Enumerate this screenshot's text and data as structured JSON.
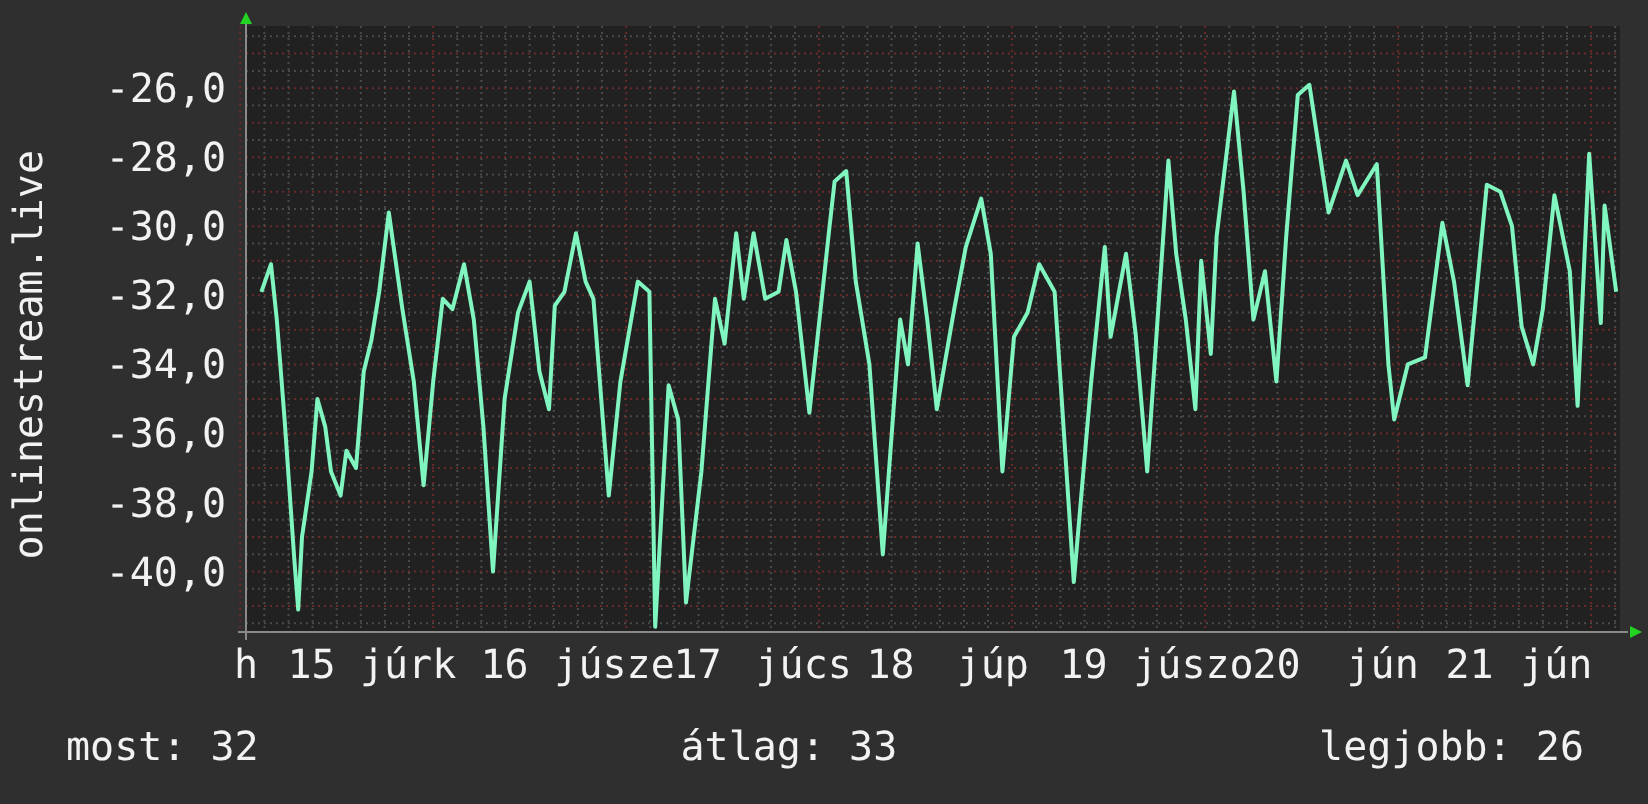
{
  "graph": {
    "chart_data": {
      "type": "line",
      "ylabel": "onlinestream.live",
      "grid": true,
      "xlim": [
        14.66,
        21.78
      ],
      "ylim": [
        -41.75,
        -24.2
      ],
      "yticks": [
        {
          "value": -26,
          "label": "-26,0"
        },
        {
          "value": -28,
          "label": "-28,0"
        },
        {
          "value": -30,
          "label": "-30,0"
        },
        {
          "value": -32,
          "label": "-32,0"
        },
        {
          "value": -34,
          "label": "-34,0"
        },
        {
          "value": -36,
          "label": "-36,0"
        },
        {
          "value": -38,
          "label": "-38,0"
        },
        {
          "value": -40,
          "label": "-40,0"
        }
      ],
      "xticks": [
        {
          "value": 14.66,
          "label": "h"
        },
        {
          "value": 15.0,
          "label": "15"
        },
        {
          "value": 15.5,
          "label": "júrk"
        },
        {
          "value": 16,
          "label": "16"
        },
        {
          "value": 16.57,
          "label": "júsze"
        },
        {
          "value": 17,
          "label": "17"
        },
        {
          "value": 17.55,
          "label": "júcs"
        },
        {
          "value": 18,
          "label": "18"
        },
        {
          "value": 18.53,
          "label": "júp"
        },
        {
          "value": 19,
          "label": "19"
        },
        {
          "value": 19.57,
          "label": "júszo"
        },
        {
          "value": 20,
          "label": "20"
        },
        {
          "value": 20.55,
          "label": "jún"
        },
        {
          "value": 21,
          "label": "21"
        },
        {
          "value": 21.45,
          "label": "jún"
        }
      ],
      "x": [
        14.74,
        14.79,
        14.82,
        14.86,
        14.91,
        14.93,
        14.95,
        15.0,
        15.03,
        15.07,
        15.1,
        15.15,
        15.18,
        15.23,
        15.27,
        15.31,
        15.35,
        15.4,
        15.47,
        15.53,
        15.58,
        15.63,
        15.68,
        15.73,
        15.79,
        15.84,
        15.89,
        15.94,
        16.0,
        16.07,
        16.13,
        16.18,
        16.23,
        16.26,
        16.31,
        16.37,
        16.42,
        16.46,
        16.54,
        16.6,
        16.69,
        16.75,
        16.78,
        16.85,
        16.9,
        16.94,
        17.02,
        17.09,
        17.14,
        17.2,
        17.24,
        17.29,
        17.35,
        17.42,
        17.46,
        17.51,
        17.58,
        17.68,
        17.71,
        17.77,
        17.82,
        17.89,
        17.96,
        18.05,
        18.09,
        18.14,
        18.19,
        18.24,
        18.33,
        18.39,
        18.47,
        18.52,
        18.58,
        18.64,
        18.71,
        18.77,
        18.85,
        18.95,
        19.04,
        19.11,
        19.14,
        19.22,
        19.27,
        19.33,
        19.44,
        19.48,
        19.53,
        19.58,
        19.61,
        19.66,
        19.69,
        19.78,
        19.83,
        19.88,
        19.94,
        20.0,
        20.05,
        20.11,
        20.17,
        20.23,
        20.27,
        20.36,
        20.42,
        20.52,
        20.58,
        20.61,
        20.68,
        20.77,
        20.86,
        20.92,
        20.99,
        21.09,
        21.16,
        21.22,
        21.27,
        21.33,
        21.38,
        21.44,
        21.52,
        21.56,
        21.62,
        21.68,
        21.7,
        21.76
      ],
      "series": [
        {
          "color": "#80f5c0",
          "values": [
            -31.9,
            -31.1,
            -32.7,
            -35.6,
            -39.6,
            -41.1,
            -39.0,
            -37.1,
            -35.0,
            -35.8,
            -37.1,
            -37.8,
            -36.5,
            -37.0,
            -34.2,
            -33.3,
            -31.9,
            -29.6,
            -32.4,
            -34.5,
            -37.5,
            -34.5,
            -32.1,
            -32.4,
            -31.1,
            -32.7,
            -35.8,
            -40.0,
            -35.0,
            -32.5,
            -31.6,
            -34.2,
            -35.3,
            -32.3,
            -31.9,
            -30.2,
            -31.6,
            -32.1,
            -37.8,
            -34.5,
            -31.6,
            -31.9,
            -41.6,
            -34.6,
            -35.6,
            -40.9,
            -37.1,
            -32.1,
            -33.4,
            -30.2,
            -32.1,
            -30.2,
            -32.1,
            -31.9,
            -30.4,
            -31.9,
            -35.4,
            -30.2,
            -28.7,
            -28.4,
            -31.6,
            -34.0,
            -39.5,
            -32.7,
            -34.0,
            -30.5,
            -32.7,
            -35.3,
            -32.4,
            -30.6,
            -29.2,
            -30.8,
            -37.1,
            -33.2,
            -32.5,
            -31.1,
            -31.9,
            -40.3,
            -34.5,
            -30.6,
            -33.2,
            -30.8,
            -33.1,
            -37.1,
            -28.1,
            -30.8,
            -32.7,
            -35.3,
            -31.0,
            -33.7,
            -30.3,
            -26.1,
            -29.0,
            -32.7,
            -31.3,
            -34.5,
            -30.3,
            -26.2,
            -25.9,
            -28.1,
            -29.6,
            -28.1,
            -29.1,
            -28.2,
            -34.0,
            -35.6,
            -34.0,
            -33.8,
            -29.9,
            -31.6,
            -34.6,
            -28.8,
            -29.0,
            -30.0,
            -32.9,
            -34.0,
            -32.4,
            -29.1,
            -31.3,
            -35.2,
            -27.9,
            -32.8,
            -29.4,
            -31.9
          ]
        }
      ]
    }
  },
  "stats": [
    "most: 32",
    "átlag: 33",
    "legjobb: 26"
  ]
}
